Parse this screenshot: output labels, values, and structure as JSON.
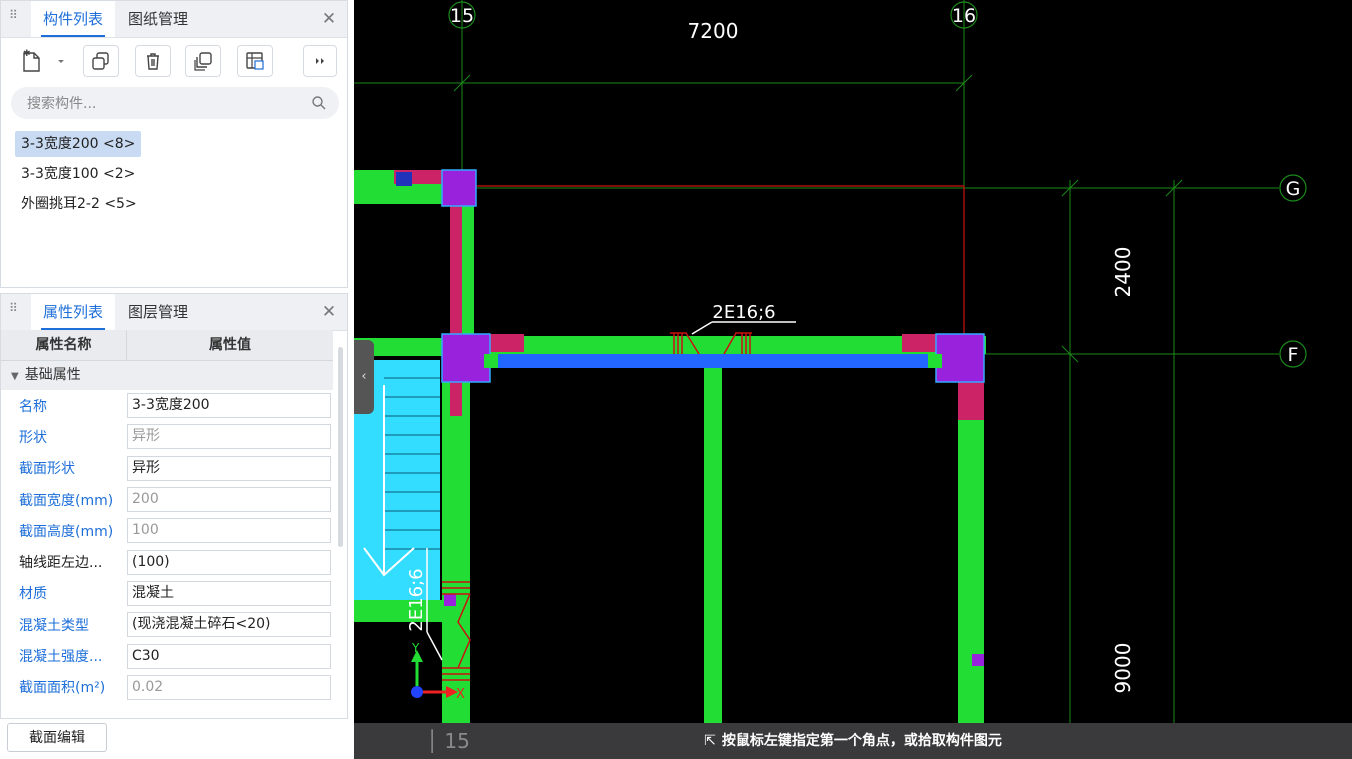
{
  "component_panel": {
    "tabs": [
      {
        "label": "构件列表",
        "active": true
      },
      {
        "label": "图纸管理",
        "active": false
      }
    ],
    "toolbar": [
      "new-component-icon",
      "dropdown-arrow-icon",
      "copy-icon",
      "delete-icon",
      "duplicate-icon",
      "layer-copy-icon",
      "more-icon"
    ],
    "search_placeholder": "搜索构件...",
    "items": [
      {
        "label": "3-3宽度200 <8>",
        "selected": true
      },
      {
        "label": "3-3宽度100 <2>",
        "selected": false
      },
      {
        "label": "外圈挑耳2-2 <5>",
        "selected": false
      }
    ]
  },
  "property_panel": {
    "tabs": [
      {
        "label": "属性列表",
        "active": true
      },
      {
        "label": "图层管理",
        "active": false
      }
    ],
    "header": {
      "name": "属性名称",
      "value": "属性值"
    },
    "group": "基础属性",
    "rows": [
      {
        "key": "名称",
        "value": "3-3宽度200",
        "key_color": "blue",
        "dim": false
      },
      {
        "key": "形状",
        "value": "异形",
        "key_color": "blue",
        "dim": true
      },
      {
        "key": "截面形状",
        "value": "异形",
        "key_color": "blue",
        "dim": false
      },
      {
        "key": "截面宽度(mm)",
        "value": "200",
        "key_color": "blue",
        "dim": true
      },
      {
        "key": "截面高度(mm)",
        "value": "100",
        "key_color": "blue",
        "dim": true
      },
      {
        "key": "轴线距左边...",
        "value": "(100)",
        "key_color": "dark",
        "dim": false
      },
      {
        "key": "材质",
        "value": "混凝土",
        "key_color": "blue",
        "dim": false
      },
      {
        "key": "混凝土类型",
        "value": "(现浇混凝土碎石<20)",
        "key_color": "blue",
        "dim": false
      },
      {
        "key": "混凝土强度...",
        "value": "C30",
        "key_color": "blue",
        "dim": false
      },
      {
        "key": "截面面积(m²)",
        "value": "0.02",
        "key_color": "blue",
        "dim": true
      }
    ]
  },
  "bottom_button": "截面编辑",
  "cad": {
    "axis_labels": {
      "x1": "15",
      "x2": "16",
      "y1": "G",
      "y2": "F",
      "x_bottom": "15"
    },
    "dimensions": {
      "top": "7200",
      "right_upper": "2400",
      "right_lower": "9000"
    },
    "rebar_labels": {
      "horizontal": "2E16;6",
      "vertical": "2E16;6"
    },
    "ucs": {
      "x": "X",
      "y": "Y"
    },
    "colors": {
      "background": "#000000",
      "beam": "#22dd33",
      "column": "#9922dd",
      "grid": "#1a8a1a",
      "axis_red": "#cc1111",
      "slab": "#33ddff",
      "blue": "#2266ff",
      "magenta": "#cc2266"
    }
  },
  "status_text": "按鼠标左键指定第一个角点，或拾取构件图元"
}
